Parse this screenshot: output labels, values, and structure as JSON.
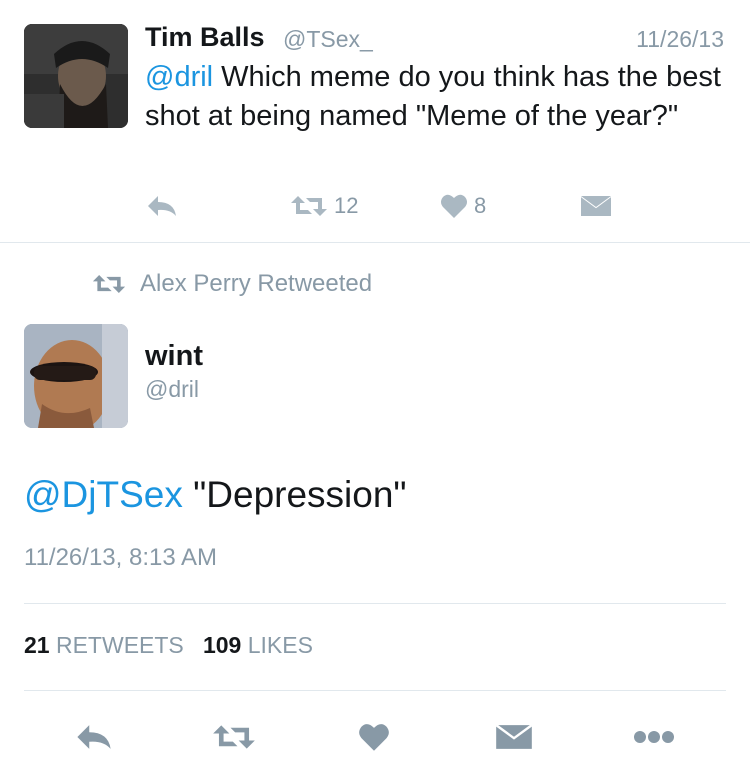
{
  "colors": {
    "link": "#1b95e0",
    "muted": "#8899a6",
    "text": "#14171a",
    "icon": "#aab8c2",
    "icon_dark": "#8899a6",
    "divider": "#e1e8ed"
  },
  "reply_tweet": {
    "name": "Tim Balls",
    "handle": "@TSex_",
    "date": "11/26/13",
    "mention": "@dril",
    "text": " Which meme do you think has the best shot at being named \"Meme of the year?\"",
    "retweet_count": "12",
    "like_count": "8"
  },
  "retweet_notice": "Alex Perry Retweeted",
  "main_tweet": {
    "name": "wint",
    "handle": "@dril",
    "mention": "@DjTSex",
    "text": " \"Depression\"",
    "timestamp": "11/26/13, 8:13 AM",
    "retweets_count": "21",
    "retweets_label": "RETWEETS",
    "likes_count": "109",
    "likes_label": "LIKES"
  },
  "icons": {
    "reply": "reply-icon",
    "retweet": "retweet-icon",
    "like": "heart-icon",
    "message": "envelope-icon",
    "more": "more-icon"
  }
}
